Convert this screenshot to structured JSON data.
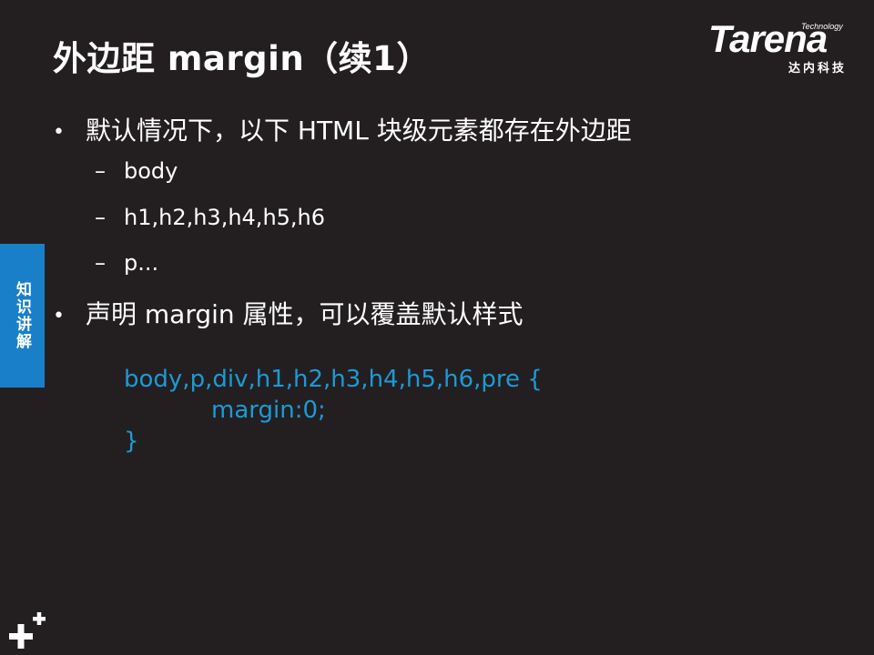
{
  "title": "外边距 margin（续1）",
  "logo": {
    "tagline": "Technology",
    "wordmark": "Tarena",
    "cn": "达内科技"
  },
  "side_tab": "知识讲解",
  "bullets": [
    "默认情况下，以下 HTML 块级元素都存在外边距",
    "声明 margin 属性，可以覆盖默认样式"
  ],
  "sub_items": {
    "bullet_glyph": "•",
    "dash_glyph": "–",
    "items": [
      "body",
      "h1,h2,h3,h4,h5,h6",
      "p..."
    ]
  },
  "code": {
    "line1": "body,p,div,h1,h2,h3,h4,h5,h6,pre {",
    "line2": "margin:0;",
    "line3": "}"
  },
  "colors": {
    "background": "#231f20",
    "accent_blue": "#1a7fc9",
    "code_blue": "#1c9ad6"
  },
  "corner_icon": "plus-plus-icon"
}
